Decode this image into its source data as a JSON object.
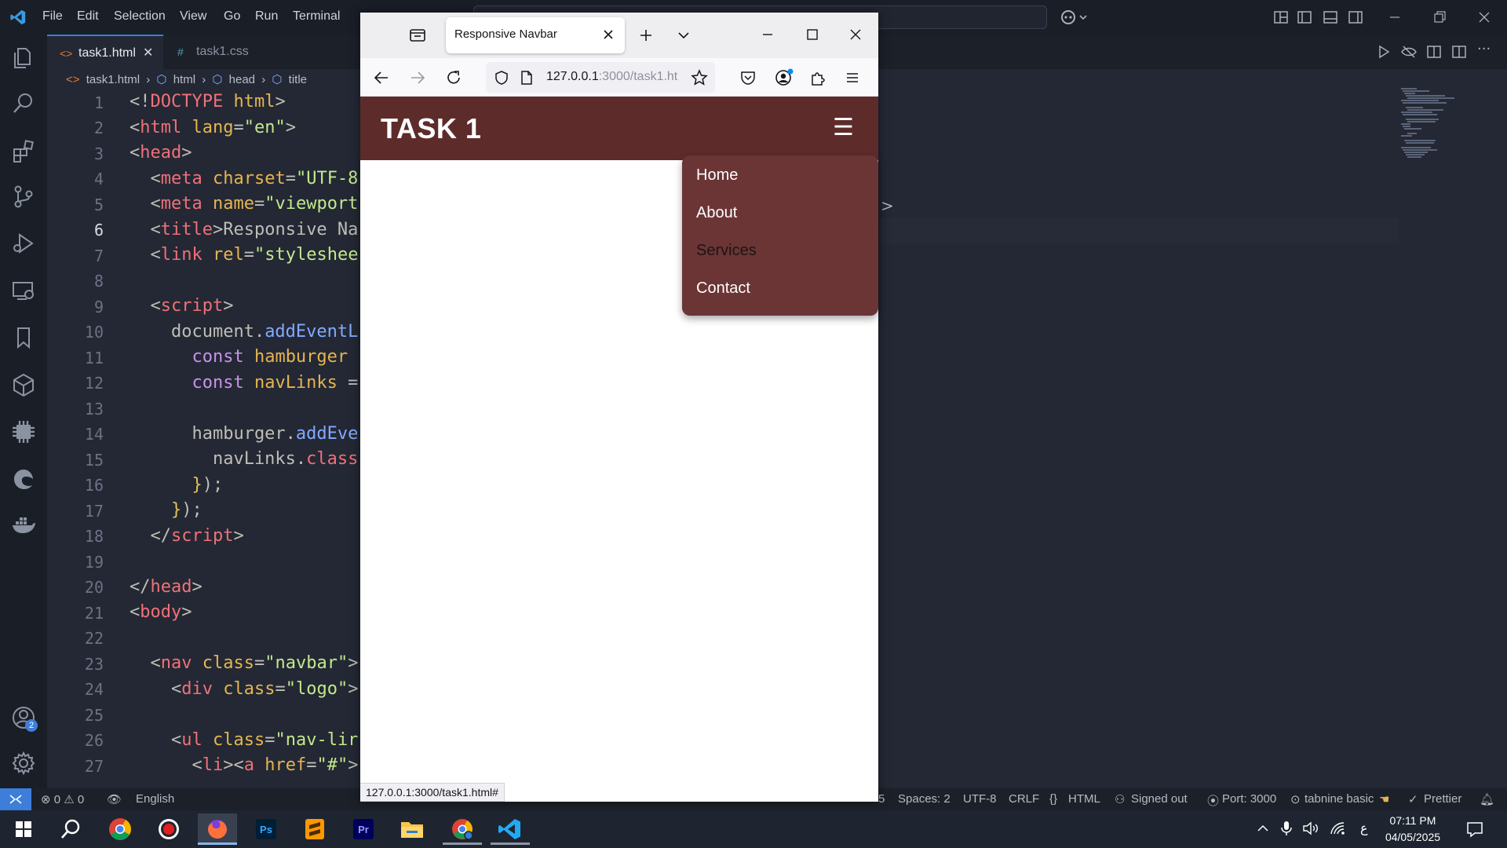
{
  "vscode": {
    "menu": [
      "File",
      "Edit",
      "Selection",
      "View",
      "Go",
      "Run",
      "Terminal"
    ],
    "tabs": [
      {
        "label": "task1.html",
        "active": true
      },
      {
        "label": "task1.css",
        "active": false
      }
    ],
    "breadcrumb": [
      "task1.html",
      "html",
      "head",
      "title"
    ],
    "line_numbers": [
      "1",
      "2",
      "3",
      "4",
      "5",
      "6",
      "7",
      "8",
      "9",
      "10",
      "11",
      "12",
      "13",
      "14",
      "15",
      "16",
      "17",
      "18",
      "19",
      "20",
      "21",
      "22",
      "23",
      "24",
      "25",
      "26",
      "27"
    ],
    "current_line": "6",
    "status": {
      "errors": "0",
      "warnings": "0",
      "language_mode": "English",
      "partial_left": "5",
      "spaces": "Spaces: 2",
      "encoding": "UTF-8",
      "eol": "CRLF",
      "lang": "HTML",
      "account": "Signed out",
      "port": "Port: 3000",
      "tabnine": "tabnine basic",
      "prettier": "Prettier"
    },
    "accounts_badge": "2",
    "partial_chevron": ">"
  },
  "firefox": {
    "tab_title": "Responsive Navbar",
    "url_host": "127.0.0.1",
    "url_path": ":3000/task1.ht",
    "status_url": "127.0.0.1:3000/task1.html#",
    "page": {
      "logo": "TASK 1",
      "hamburger": "☰",
      "nav_links": [
        "Home",
        "About",
        "Services",
        "Contact"
      ]
    }
  },
  "taskbar": {
    "time": "07:11 PM",
    "date": "04/05/2025",
    "input_lang": "ع"
  },
  "colors": {
    "navbar_bg": "#5e2b2b",
    "dropdown_bg": "#6b3535",
    "editor_bg": "#232834",
    "accent": "#3d7edb"
  }
}
